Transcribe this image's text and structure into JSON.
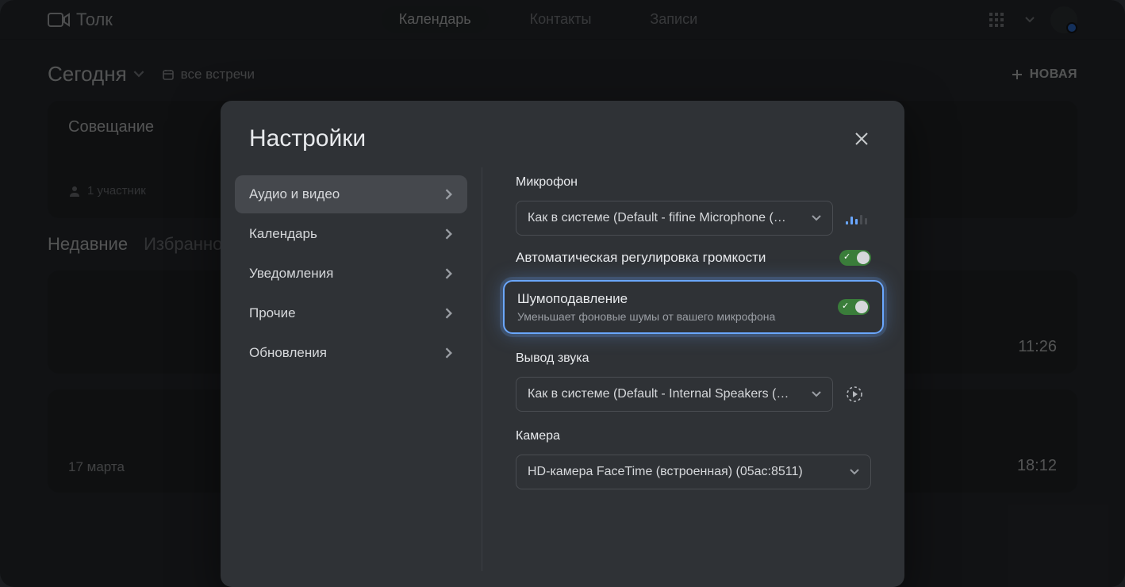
{
  "app": {
    "brand": "Толк"
  },
  "nav": {
    "tabs": [
      "Календарь",
      "Контакты",
      "Записи"
    ],
    "new_button": "НОВАЯ"
  },
  "page": {
    "today": "Сегодня",
    "all_meetings": "все встречи",
    "card": {
      "title": "Совещание",
      "participants": "1 участник"
    },
    "sections": {
      "recent": "Недавние",
      "favorites": "Избранное"
    },
    "rows": [
      {
        "date": "",
        "time": "11:26"
      },
      {
        "date": "17 марта",
        "time": "18:12"
      }
    ]
  },
  "modal": {
    "title": "Настройки",
    "sidebar": [
      "Аудио и видео",
      "Календарь",
      "Уведомления",
      "Прочие",
      "Обновления"
    ],
    "panel": {
      "mic_label": "Микрофон",
      "mic_value": "Как в системе (Default - fifine Microphone (…",
      "auto_gain": "Автоматическая регулировка громкости",
      "noise": {
        "title": "Шумоподавление",
        "desc": "Уменьшает фоновые шумы от вашего микрофона"
      },
      "output_label": "Вывод звука",
      "output_value": "Как в системе (Default - Internal Speakers (…",
      "camera_label": "Камера",
      "camera_value": "HD-камера FaceTime (встроенная) (05ac:8511)"
    }
  }
}
